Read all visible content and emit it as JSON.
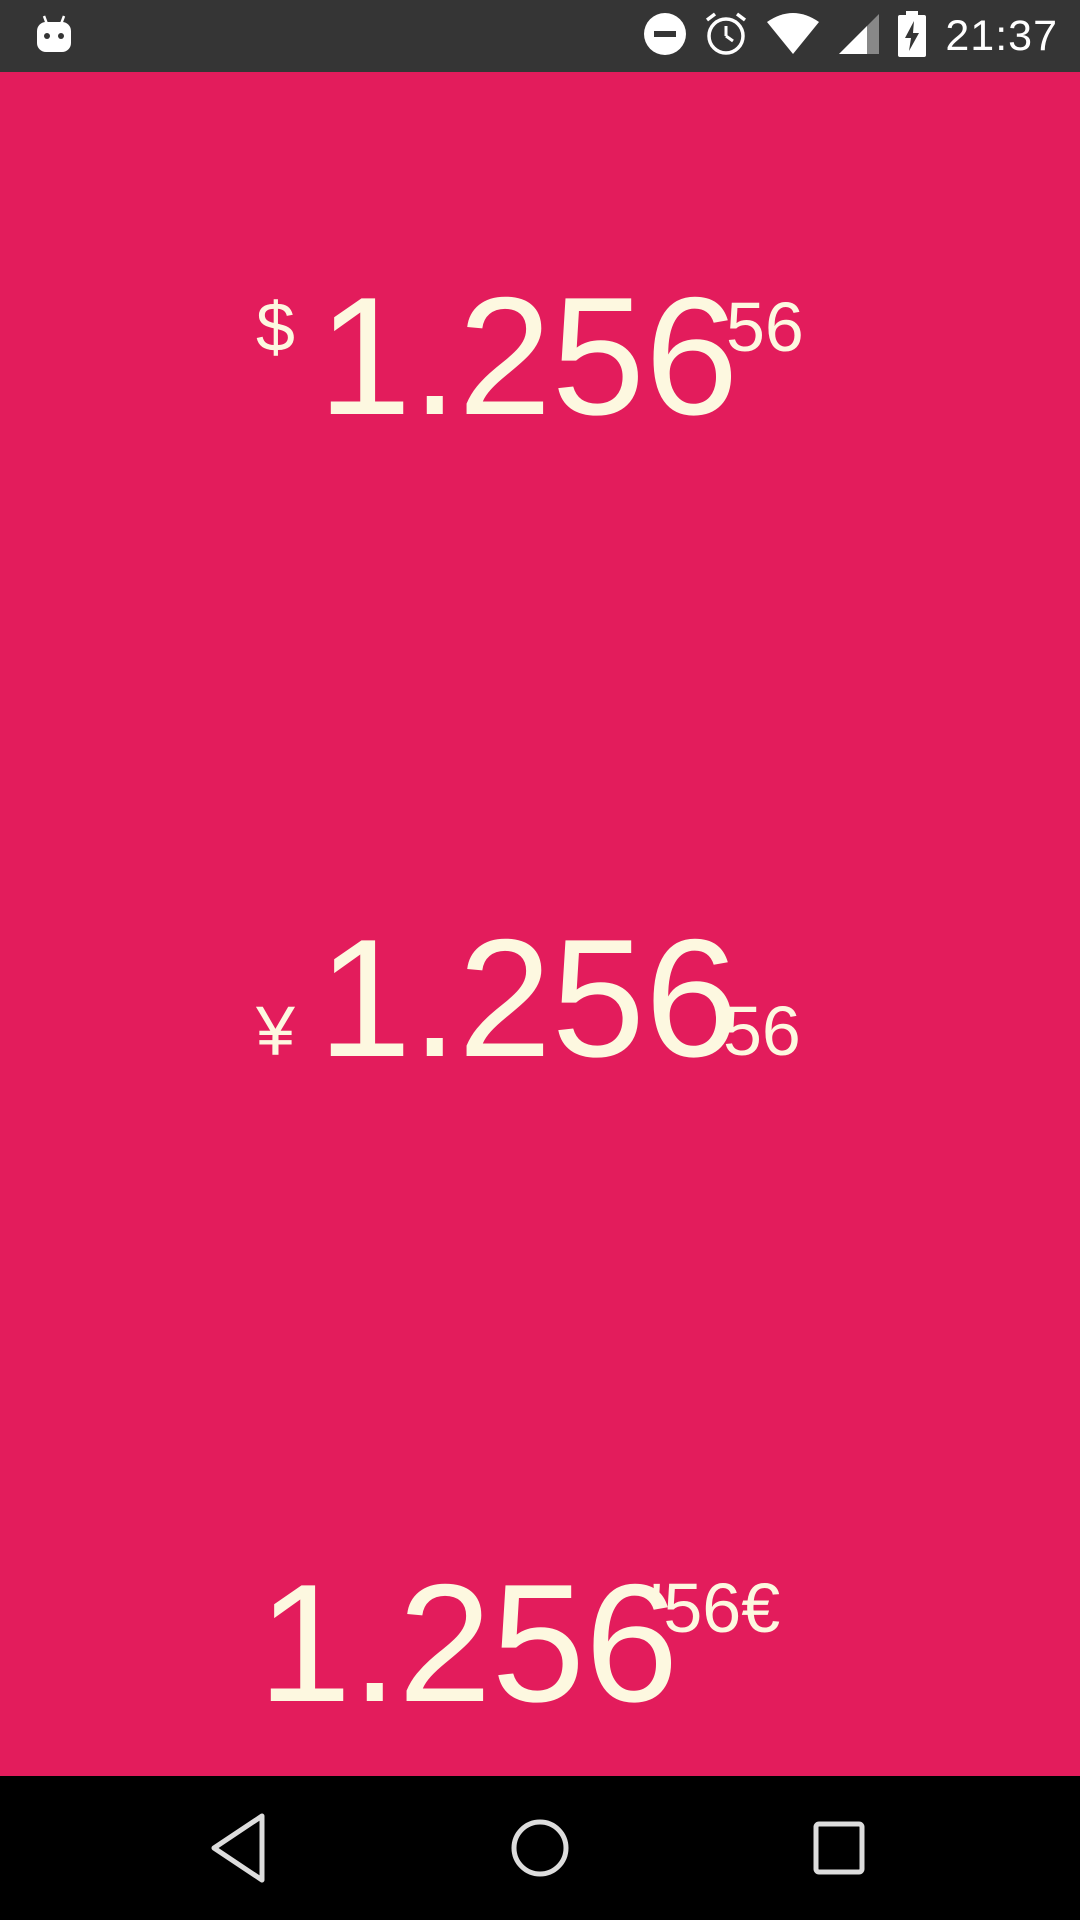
{
  "status_bar": {
    "time": "21:37",
    "icons": [
      "android-icon",
      "do-not-disturb-icon",
      "alarm-icon",
      "wifi-icon",
      "cell-signal-icon",
      "battery-charging-icon"
    ]
  },
  "amounts": [
    {
      "symbol": "$",
      "integer": "1.256",
      "decimal": "56"
    },
    {
      "symbol": "¥",
      "integer": "1.256",
      "decimal": "56"
    },
    {
      "symbol": "",
      "integer": "1.256",
      "decimal": "'56€"
    }
  ],
  "colors": {
    "background": "#e31c5c",
    "text": "#fdf8e0",
    "status_bar": "#353535",
    "nav_bar": "#000000"
  },
  "nav_bar": {
    "buttons": [
      "back-icon",
      "home-icon",
      "recent-apps-icon"
    ]
  }
}
